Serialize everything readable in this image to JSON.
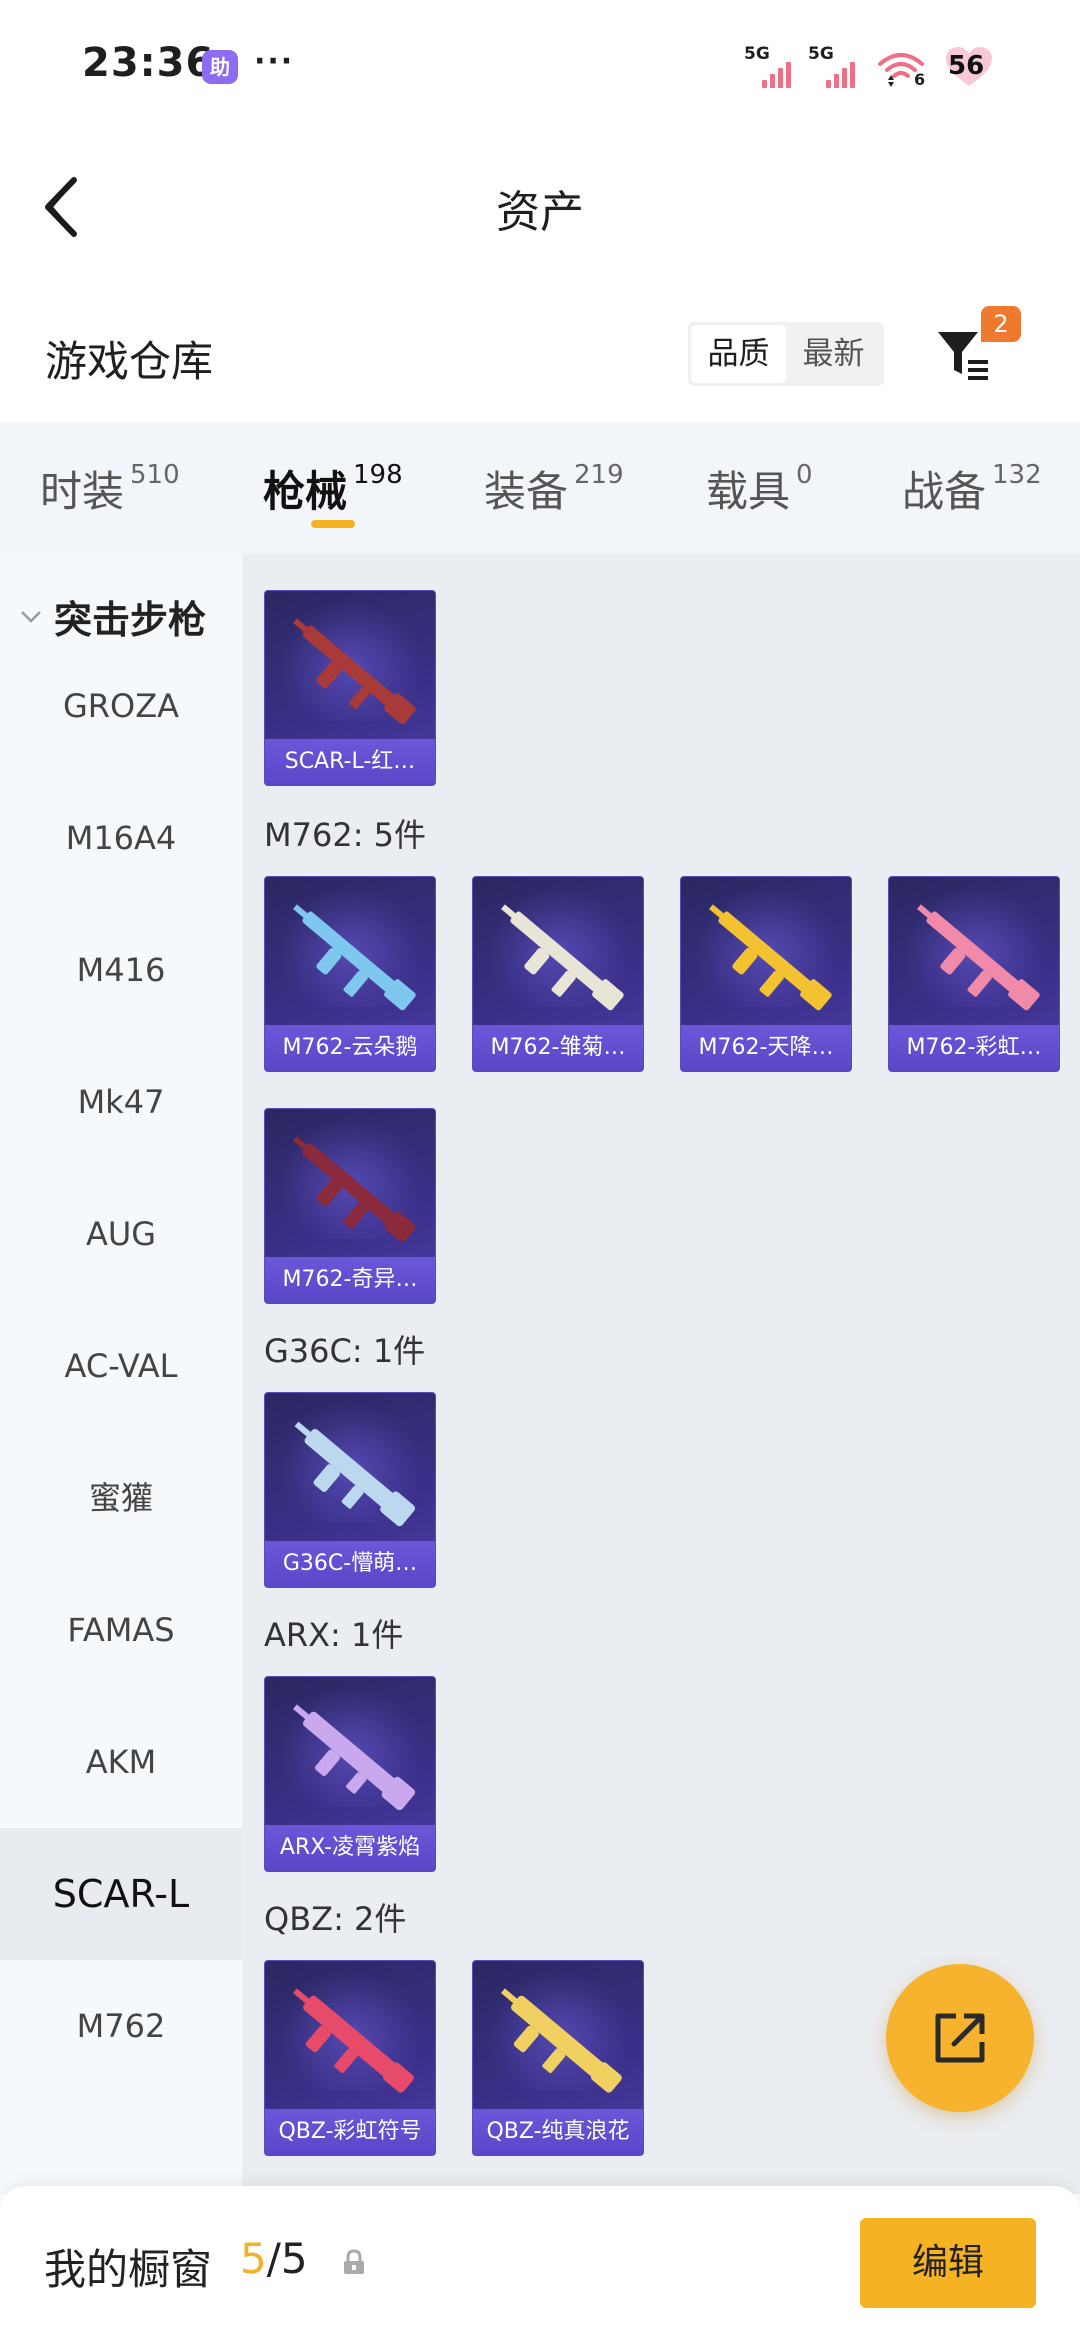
{
  "status_bar": {
    "time": "23:36",
    "assist_badge": "助",
    "more": "···",
    "sim1": "5G",
    "sim2": "5G",
    "wifi_num": "6",
    "battery": "56"
  },
  "header": {
    "title": "资产"
  },
  "warehouse": {
    "title": "游戏仓库",
    "sort_options": [
      "品质",
      "最新"
    ],
    "active_sort": "品质",
    "filter_badge": "2"
  },
  "tabs": [
    {
      "name": "时装",
      "count": "510"
    },
    {
      "name": "枪械",
      "count": "198"
    },
    {
      "name": "装备",
      "count": "219"
    },
    {
      "name": "载具",
      "count": "0"
    },
    {
      "name": "战备",
      "count": "132"
    }
  ],
  "active_tab": "枪械",
  "sidebar": {
    "category": "突击步枪",
    "items": [
      "GROZA",
      "M16A4",
      "M416",
      "Mk47",
      "AUG",
      "AC-VAL",
      "蜜獾",
      "FAMAS",
      "AKM",
      "SCAR-L",
      "M762"
    ],
    "active": "SCAR-L"
  },
  "groups": [
    {
      "title": "",
      "items": [
        "SCAR-L-红…"
      ]
    },
    {
      "title": "M762: 5件",
      "items": [
        "M762-云朵鹅",
        "M762-雏菊…",
        "M762-天降…",
        "M762-彩虹…",
        "M762-奇异…"
      ]
    },
    {
      "title": "G36C: 1件",
      "items": [
        "G36C-懵萌…"
      ]
    },
    {
      "title": "ARX: 1件",
      "items": [
        "ARX-凌霄紫焰"
      ]
    },
    {
      "title": "QBZ: 2件",
      "items": [
        "QBZ-彩虹符号",
        "QBZ-纯真浪花"
      ]
    }
  ],
  "gun_colors": [
    "#a83a3a",
    "#7ec8f0",
    "#e8e4d6",
    "#f2c230",
    "#f08aa8",
    "#8a2a3a",
    "#bcd8ee",
    "#c9a8ee",
    "#e84a6a",
    "#f0d060"
  ],
  "bottom_bar": {
    "label": "我的橱窗",
    "current": "5",
    "total": "/5",
    "edit": "编辑"
  }
}
